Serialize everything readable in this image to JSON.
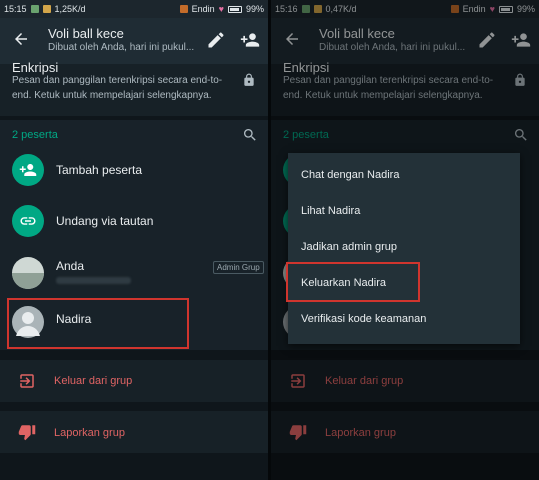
{
  "left": {
    "status": {
      "time": "15:15",
      "speed": "1,25K/d",
      "operator": "Endin",
      "battery": "99%"
    },
    "header": {
      "title": "Voli ball kece",
      "subtitle": "Dibuat oleh Anda, hari ini pukul..."
    },
    "encryption": {
      "title": "Enkripsi",
      "description": "Pesan dan panggilan terenkripsi secara end-to-end. Ketuk untuk mempelajari selengkapnya."
    },
    "members": {
      "header": "2 peserta",
      "add_label": "Tambah peserta",
      "invite_label": "Undang via tautan",
      "you": {
        "name": "Anda",
        "badge": "Admin Grup"
      },
      "nadira": {
        "name": "Nadira"
      }
    },
    "actions": {
      "exit": "Keluar dari grup",
      "report": "Laporkan grup"
    }
  },
  "right": {
    "status": {
      "time": "15:16",
      "speed": "0,47K/d",
      "operator": "Endin",
      "battery": "99%"
    },
    "header": {
      "title": "Voli ball kece",
      "subtitle": "Dibuat oleh Anda, hari ini pukul..."
    },
    "encryption": {
      "title": "Enkripsi",
      "description": "Pesan dan panggilan terenkripsi secara end-to-end. Ketuk untuk mempelajari selengkapnya."
    },
    "members": {
      "header": "2 peserta"
    },
    "actions": {
      "exit": "Keluar dari grup",
      "report": "Laporkan grup"
    },
    "menu": {
      "items": [
        "Chat dengan Nadira",
        "Lihat Nadira",
        "Jadikan admin grup",
        "Keluarkan Nadira",
        "Verifikasi kode keamanan"
      ]
    }
  },
  "colors": {
    "accent": "#00a884",
    "danger": "#e06464",
    "highlight": "#d0352e"
  }
}
